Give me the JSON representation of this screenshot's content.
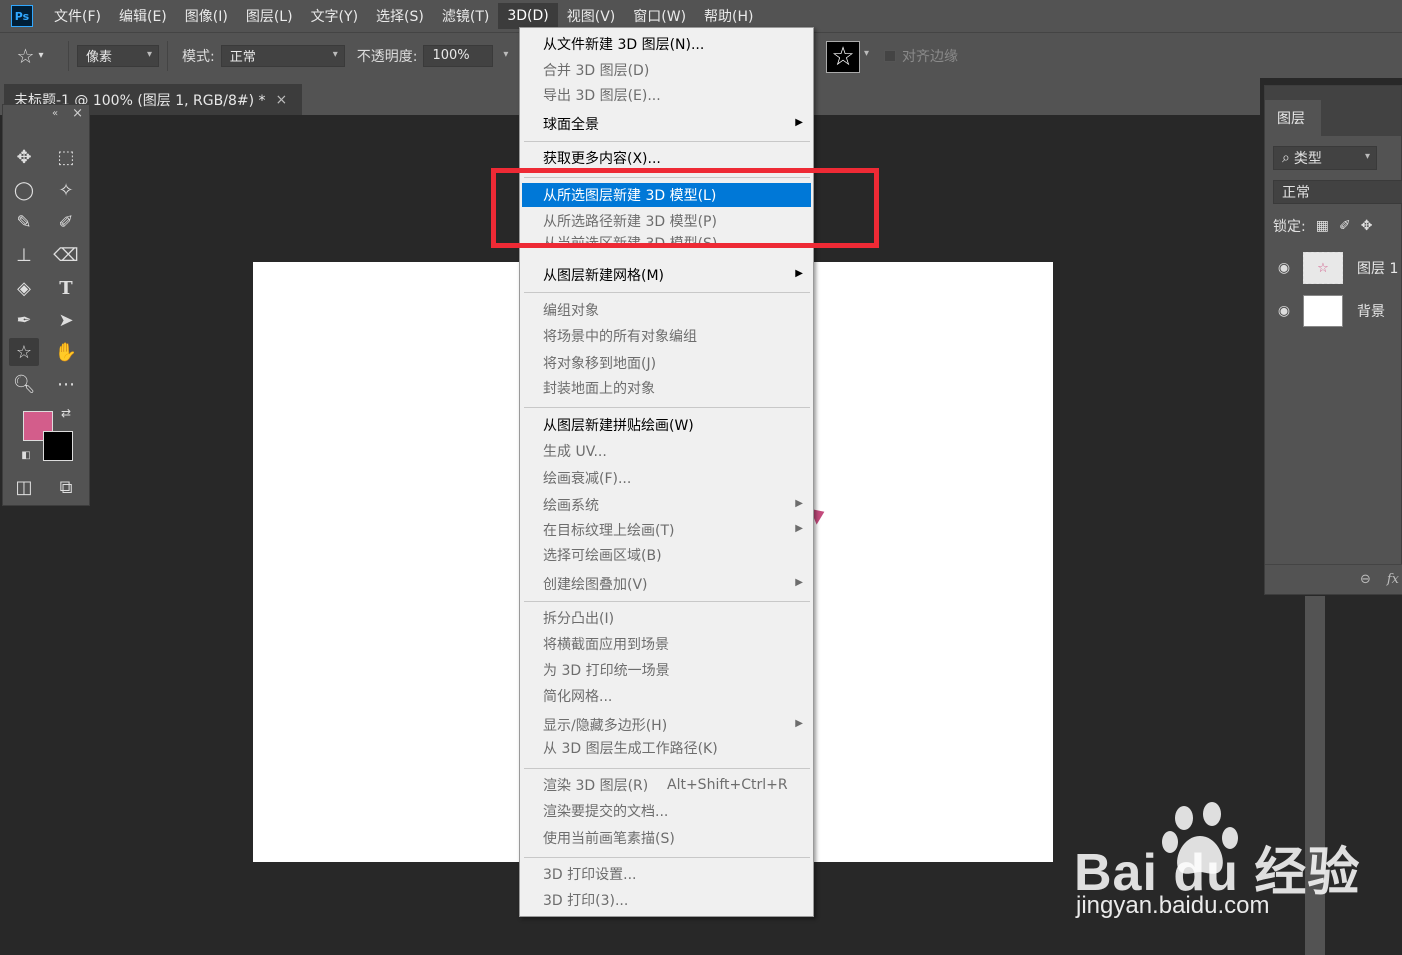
{
  "app": {
    "logo": "Ps"
  },
  "menubar": [
    "文件(F)",
    "编辑(E)",
    "图像(I)",
    "图层(L)",
    "文字(Y)",
    "选择(S)",
    "滤镜(T)",
    "3D(D)",
    "视图(V)",
    "窗口(W)",
    "帮助(H)"
  ],
  "options": {
    "pixel_value": "像素",
    "mode_label": "模式:",
    "mode_value": "正常",
    "opacity_label": "不透明度:",
    "opacity_value": "100%",
    "align_label": "对齐边缘"
  },
  "document": {
    "tab_title": "未标题-1 @ 100% (图层 1, RGB/8#) *",
    "close_glyph": "×"
  },
  "colors": {
    "foreground": "#d35d8b",
    "background": "#000000",
    "highlight": "#0078d7",
    "annotation": "#ee2a35"
  },
  "menu_3d": {
    "items": [
      {
        "label": "从文件新建 3D 图层(N)...",
        "state": "enabled"
      },
      {
        "label": "合并 3D 图层(D)",
        "state": "disabled"
      },
      {
        "label": "导出 3D 图层(E)...",
        "state": "disabled"
      },
      {
        "label": "球面全景",
        "state": "enabled",
        "submenu": true
      },
      {
        "label": "获取更多内容(X)...",
        "state": "enabled"
      },
      {
        "label": "从所选图层新建 3D 模型(L)",
        "state": "highlighted"
      },
      {
        "label": "从所选路径新建 3D 模型(P)",
        "state": "disabled"
      },
      {
        "label": "从当前选区新建 3D 模型(S)",
        "state": "disabled"
      },
      {
        "label": "从图层新建网格(M)",
        "state": "enabled",
        "submenu": true
      },
      {
        "label": "编组对象",
        "state": "disabled"
      },
      {
        "label": "将场景中的所有对象编组",
        "state": "disabled"
      },
      {
        "label": "将对象移到地面(J)",
        "state": "disabled"
      },
      {
        "label": "封装地面上的对象",
        "state": "disabled"
      },
      {
        "label": "从图层新建拼贴绘画(W)",
        "state": "enabled"
      },
      {
        "label": "生成 UV...",
        "state": "disabled"
      },
      {
        "label": "绘画衰减(F)...",
        "state": "disabled"
      },
      {
        "label": "绘画系统",
        "state": "disabled",
        "submenu": true
      },
      {
        "label": "在目标纹理上绘画(T)",
        "state": "disabled",
        "submenu": true
      },
      {
        "label": "选择可绘画区域(B)",
        "state": "disabled"
      },
      {
        "label": "创建绘图叠加(V)",
        "state": "disabled",
        "submenu": true
      },
      {
        "label": "拆分凸出(I)",
        "state": "disabled"
      },
      {
        "label": "将横截面应用到场景",
        "state": "disabled"
      },
      {
        "label": "为 3D 打印统一场景",
        "state": "disabled"
      },
      {
        "label": "简化网格...",
        "state": "disabled"
      },
      {
        "label": "显示/隐藏多边形(H)",
        "state": "disabled",
        "submenu": true
      },
      {
        "label": "从 3D 图层生成工作路径(K)",
        "state": "disabled"
      },
      {
        "label": "渲染 3D 图层(R)",
        "state": "disabled",
        "shortcut": "Alt+Shift+Ctrl+R"
      },
      {
        "label": "渲染要提交的文档...",
        "state": "disabled"
      },
      {
        "label": "使用当前画笔素描(S)",
        "state": "disabled"
      },
      {
        "label": "3D 打印设置...",
        "state": "disabled"
      },
      {
        "label": "3D 打印(3)...",
        "state": "disabled"
      }
    ]
  },
  "layers_panel": {
    "tab": "图层",
    "filter": "类型",
    "blend_mode": "正常",
    "lock_label": "锁定:",
    "layers": [
      {
        "name": "图层 1",
        "visible": true
      },
      {
        "name": "背景",
        "visible": true
      }
    ],
    "footer_fx": "fx"
  },
  "watermark": {
    "logo": "Bai du 经验",
    "url": "jingyan.baidu.com"
  }
}
